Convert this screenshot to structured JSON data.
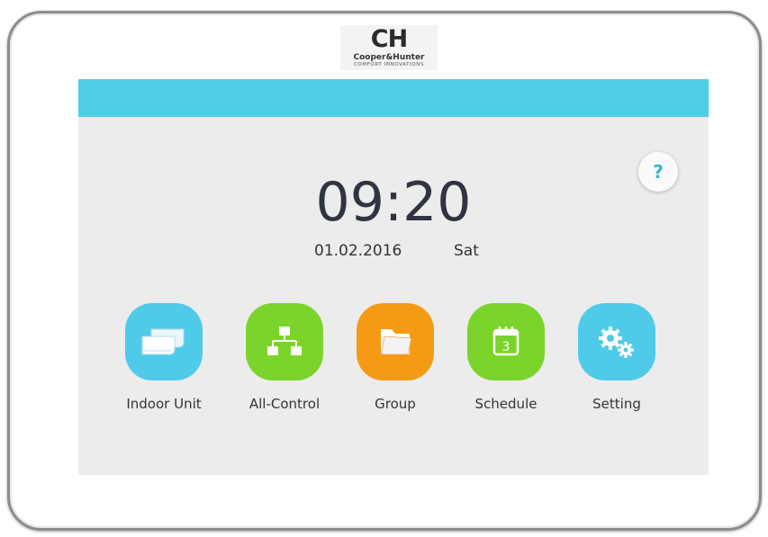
{
  "brand": {
    "mark": "CH",
    "name": "Cooper&Hunter",
    "tagline": "COMFORT INNOVATIONS"
  },
  "header": {
    "help_label": "?"
  },
  "clock": {
    "time": "09:20",
    "date": "01.02.2016",
    "day": "Sat"
  },
  "menu": [
    {
      "label": "Indoor Unit",
      "icon": "indoor-unit-icon",
      "color": "#4fcbe9"
    },
    {
      "label": "All-Control",
      "icon": "network-tree-icon",
      "color": "#7bd42b"
    },
    {
      "label": "Group",
      "icon": "folder-icon",
      "color": "#f49a14"
    },
    {
      "label": "Schedule",
      "icon": "calendar-icon",
      "color": "#7bd42b",
      "calendar_day": "3"
    },
    {
      "label": "Setting",
      "icon": "gears-icon",
      "color": "#4fcbe9"
    }
  ],
  "colors": {
    "accent": "#4ecde6",
    "screen_bg": "#ececec"
  }
}
